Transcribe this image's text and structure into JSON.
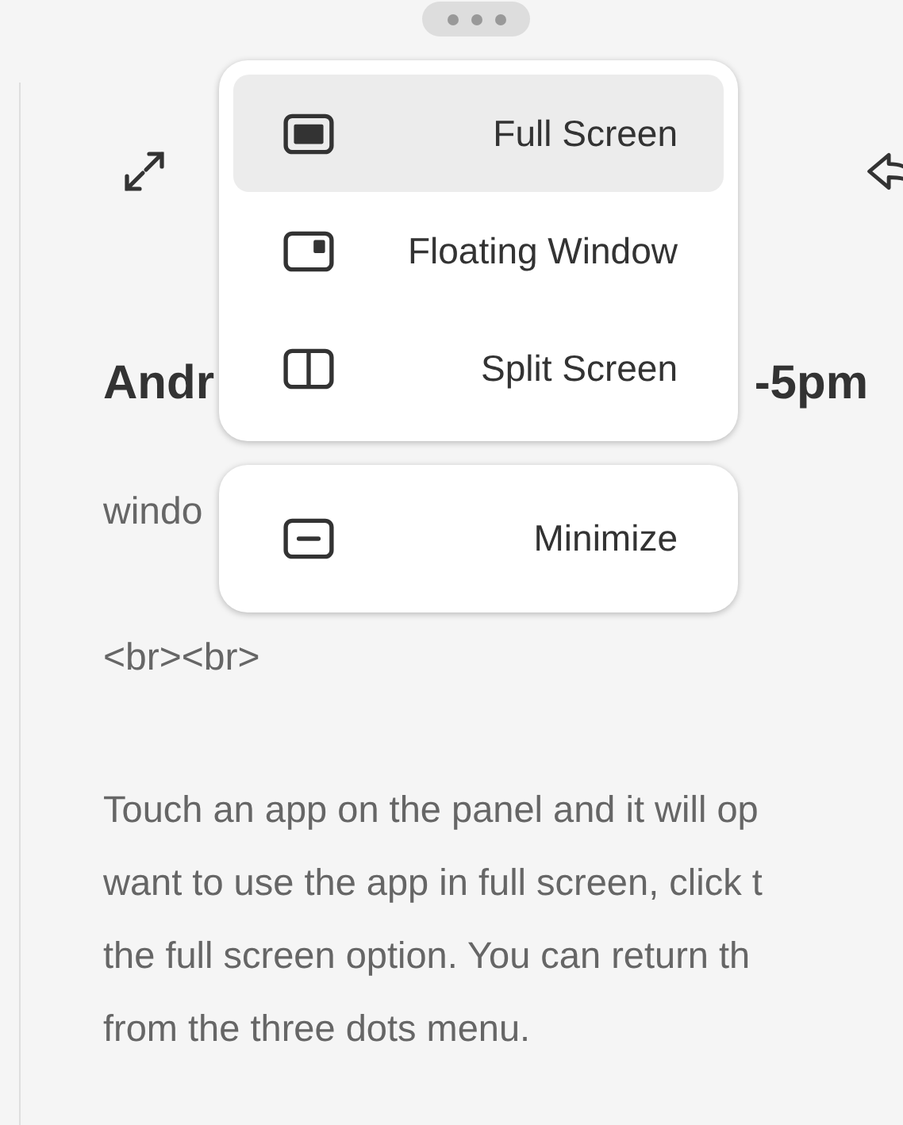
{
  "article": {
    "heading": {
      "left": "Andr",
      "right": "-5pm"
    },
    "fragment": "windo",
    "markup": "<br><br>",
    "paragraph_lines": [
      "Touch an app on the panel and it will op",
      "want to use the app in full screen, click t",
      "the full screen option. You can return th",
      "from the three dots menu."
    ]
  },
  "menu": {
    "groups": [
      {
        "items": [
          {
            "label": "Full Screen",
            "kind": "full",
            "selected": true
          },
          {
            "label": "Floating Window",
            "kind": "floating",
            "selected": false
          },
          {
            "label": "Split Screen",
            "kind": "split",
            "selected": false
          }
        ]
      },
      {
        "items": [
          {
            "label": "Minimize",
            "kind": "minimize",
            "selected": false
          }
        ]
      }
    ]
  }
}
